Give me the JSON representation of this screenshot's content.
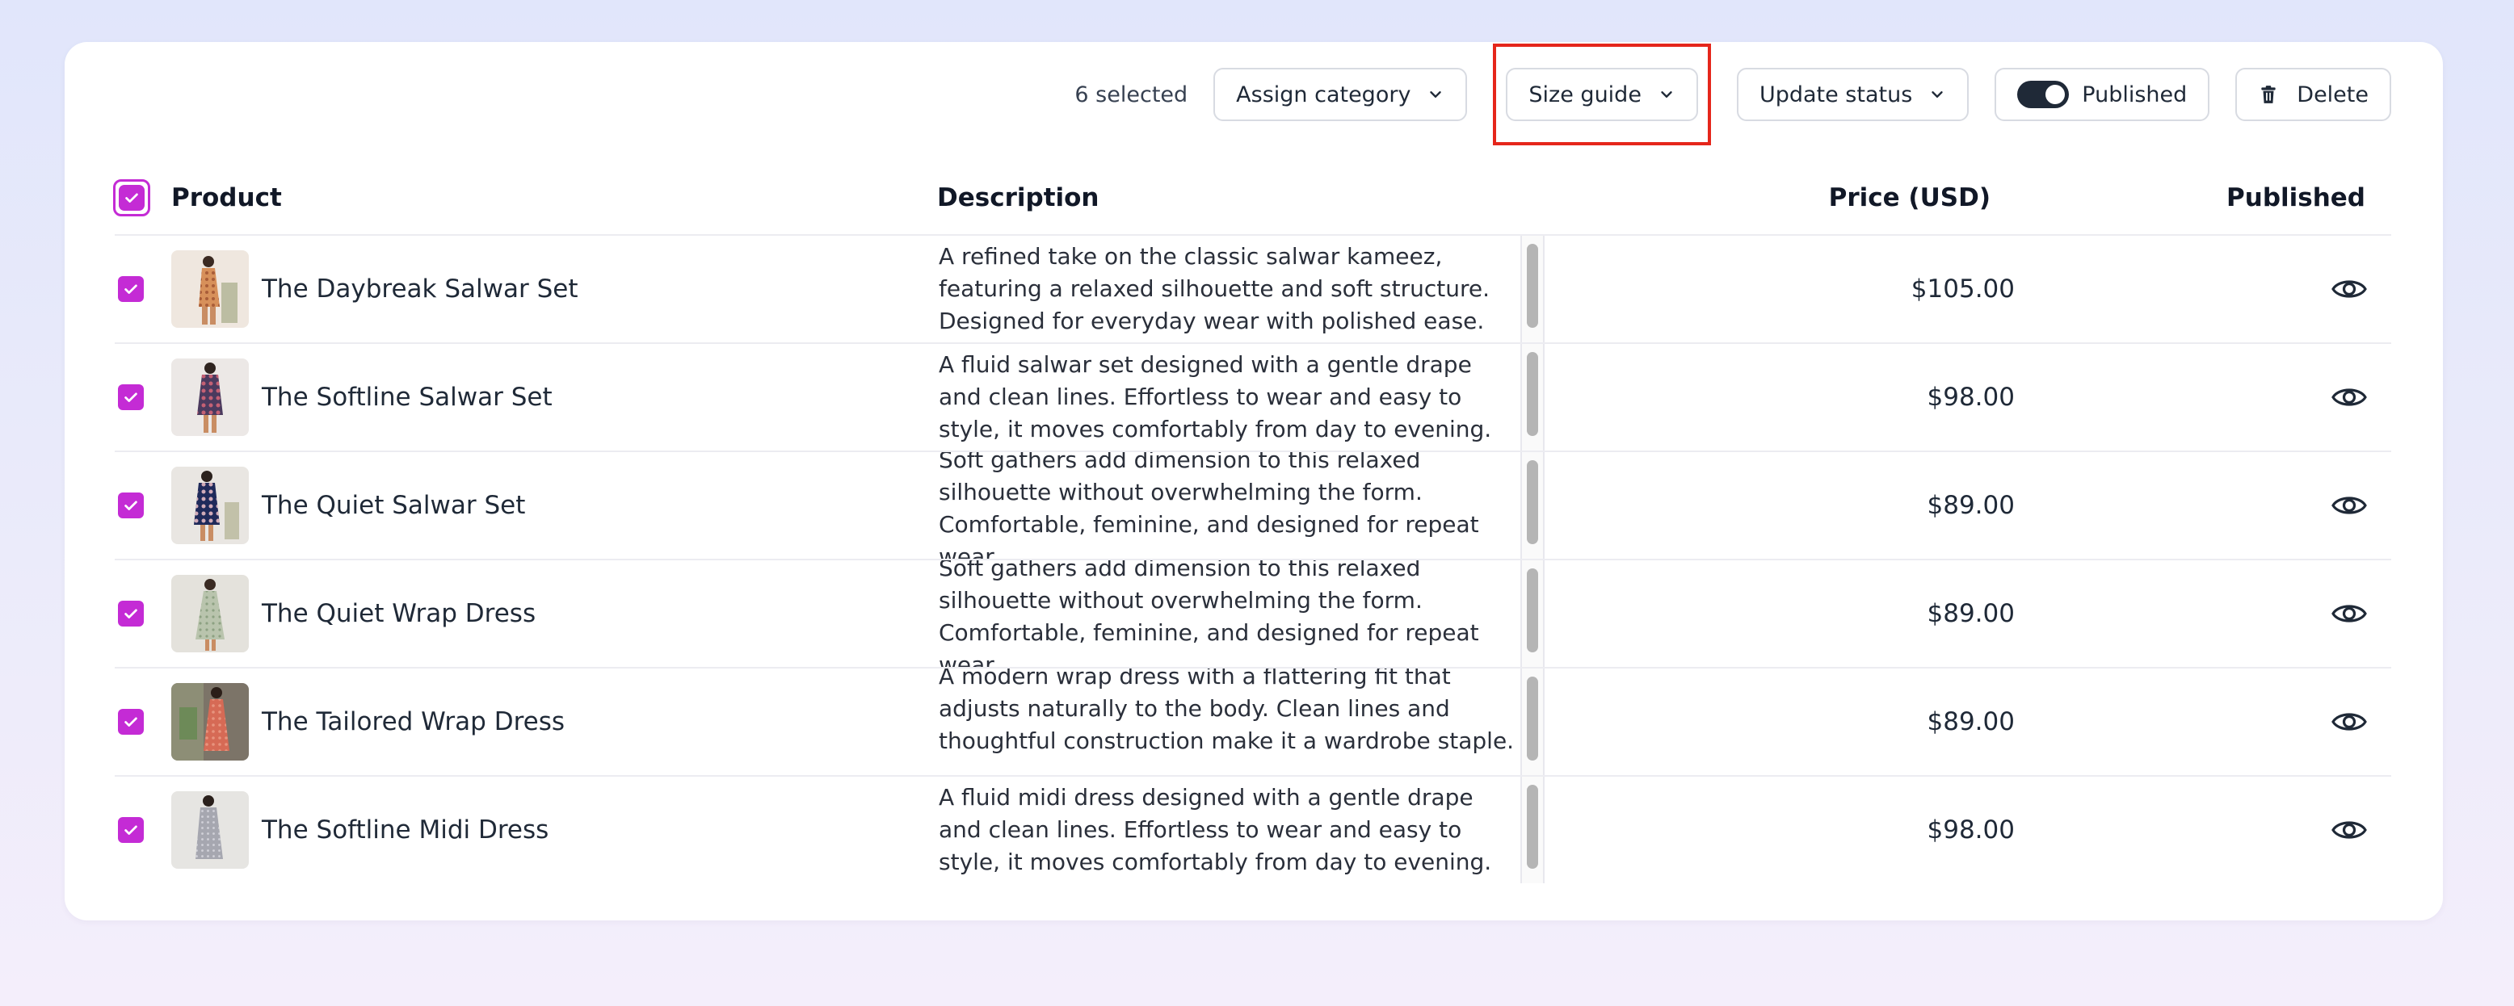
{
  "toolbar": {
    "selected_count": "6 selected",
    "assign_category": "Assign category",
    "size_guide": "Size guide",
    "update_status": "Update status",
    "published": "Published",
    "delete": "Delete"
  },
  "table": {
    "headers": {
      "product": "Product",
      "description": "Description",
      "price": "Price (USD)",
      "published": "Published"
    },
    "rows": [
      {
        "name": "The Daybreak Salwar Set",
        "description": "A refined take on the classic salwar kameez, featuring a relaxed silhouette and soft structure. Designed for everyday wear with polished ease.",
        "price": "$105.00"
      },
      {
        "name": "The Softline Salwar Set",
        "description": "A fluid salwar set designed with a gentle drape and clean lines. Effortless to wear and easy to style, it moves comfortably from day to evening.",
        "price": "$98.00"
      },
      {
        "name": "The Quiet Salwar Set",
        "description": "Soft gathers add dimension to this relaxed silhouette without overwhelming the form. Comfortable, feminine, and designed for repeat wear.",
        "price": "$89.00"
      },
      {
        "name": "The Quiet Wrap Dress",
        "description": "Soft gathers add dimension to this relaxed silhouette without overwhelming the form. Comfortable, feminine, and designed for repeat wear.",
        "price": "$89.00"
      },
      {
        "name": "The Tailored Wrap Dress",
        "description": "A modern wrap dress with a flattering fit that adjusts naturally to the body. Clean lines and thoughtful construction make it a wardrobe staple.",
        "price": "$89.00"
      },
      {
        "name": "The Softline Midi Dress",
        "description": "A fluid midi dress designed with a gentle drape and clean lines. Effortless to wear and easy to style, it moves comfortably from day to evening.",
        "price": "$98.00"
      }
    ]
  },
  "colors": {
    "accent": "#c42bd5",
    "highlight": "#e5261b",
    "toggle_on": "#1f2937"
  },
  "icons": {
    "chevron": "chevron-down-icon",
    "trash": "trash-icon",
    "visibility": "eye-icon",
    "check": "check-icon"
  }
}
